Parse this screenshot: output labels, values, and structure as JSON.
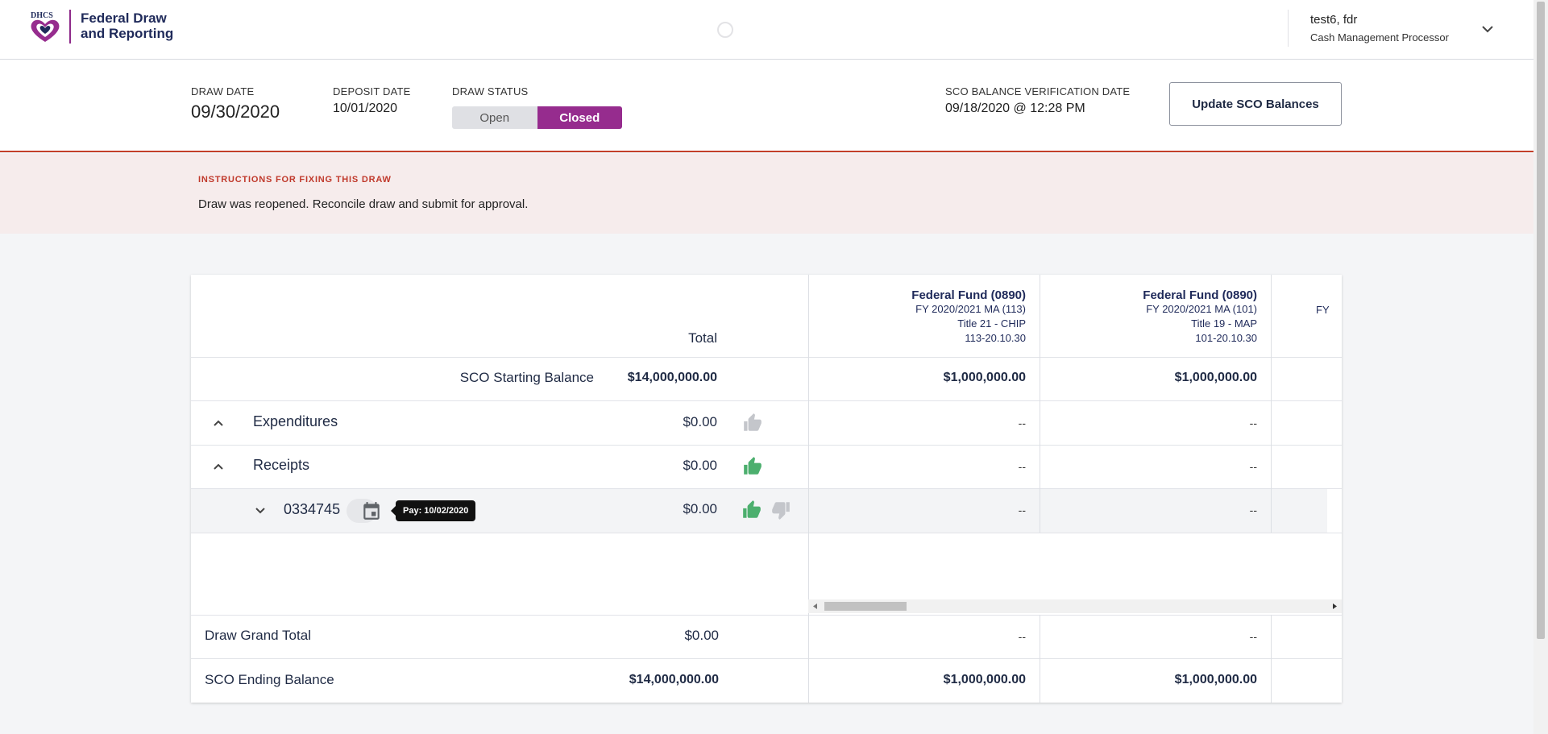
{
  "app": {
    "title_line1": "Federal Draw",
    "title_line2": "and Reporting",
    "logo_text": "DHCS",
    "colors": {
      "brand_purple": "#962c8e",
      "navy": "#1f2a5a",
      "alert_red": "#c0392b",
      "approve_green": "#4caf6e"
    }
  },
  "user": {
    "name": "test6, fdr",
    "role": "Cash Management Processor",
    "menu_icon": "chevron-down-icon"
  },
  "draw": {
    "draw_date_label": "DRAW DATE",
    "draw_date": "09/30/2020",
    "deposit_date_label": "DEPOSIT DATE",
    "deposit_date": "10/01/2020",
    "status_label": "DRAW STATUS",
    "status_options": [
      "Open",
      "Closed"
    ],
    "status_selected": "Closed",
    "sco_verify_label": "SCO BALANCE VERIFICATION DATE",
    "sco_verify_date": "09/18/2020 @ 12:28 PM",
    "update_button": "Update SCO Balances"
  },
  "instructions": {
    "label": "INSTRUCTIONS FOR FIXING THIS DRAW",
    "text": "Draw was reopened. Reconcile draw and submit for approval."
  },
  "table": {
    "total_header": "Total",
    "columns": [
      {
        "title": "Federal Fund (0890)",
        "fy": "FY 2020/2021 MA (113)",
        "program": "Title 21 - CHIP",
        "code": "113-20.10.30"
      },
      {
        "title": "Federal Fund (0890)",
        "fy": "FY 2020/2021 MA (101)",
        "program": "Title 19 - MAP",
        "code": "101-20.10.30"
      },
      {
        "title": "",
        "fy": "FY",
        "program": "",
        "code": ""
      }
    ],
    "starting_balance": {
      "label": "SCO Starting Balance",
      "total": "$14,000,000.00",
      "values": [
        "$1,000,000.00",
        "$1,000,000.00"
      ]
    },
    "expenditures": {
      "label": "Expenditures",
      "total": "$0.00",
      "values": [
        "--",
        "--"
      ]
    },
    "receipts": {
      "label": "Receipts",
      "total": "$0.00",
      "values": [
        "--",
        "--"
      ]
    },
    "receipt_item": {
      "label": "0334745",
      "tooltip": "Pay: 10/02/2020",
      "total": "$0.00",
      "values": [
        "--",
        "--"
      ]
    },
    "grand_total": {
      "label": "Draw Grand Total",
      "total": "$0.00",
      "values": [
        "--",
        "--"
      ]
    },
    "ending_balance": {
      "label": "SCO Ending Balance",
      "total": "$14,000,000.00",
      "values": [
        "$1,000,000.00",
        "$1,000,000.00"
      ]
    }
  }
}
